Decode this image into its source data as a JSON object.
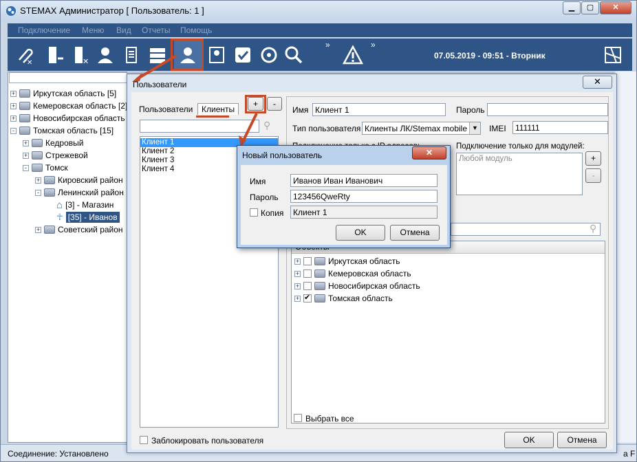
{
  "window": {
    "title": "STEMAX Администратор [ Пользователь: 1 ]"
  },
  "menu": [
    "Подключение",
    "Меню",
    "Вид",
    "Отчеты",
    "Помощь"
  ],
  "toolbar": {
    "datetime": "07.05.2019 - 09:51 - Вторник",
    "more1": "»",
    "more2": "»"
  },
  "tree": [
    {
      "label": "Иркутская область [5]",
      "level": 0,
      "sign": "+"
    },
    {
      "label": "Кемеровская область [2]",
      "level": 0,
      "sign": "+"
    },
    {
      "label": "Новосибирская область",
      "level": 0,
      "sign": "+"
    },
    {
      "label": "Томская область [15]",
      "level": 0,
      "sign": "-"
    },
    {
      "label": "Кедровый",
      "level": 1,
      "sign": "+"
    },
    {
      "label": "Стрежевой",
      "level": 1,
      "sign": "+"
    },
    {
      "label": "Томск",
      "level": 1,
      "sign": "-"
    },
    {
      "label": "Кировский район",
      "level": 2,
      "sign": "+"
    },
    {
      "label": "Ленинский район",
      "level": 2,
      "sign": "-"
    },
    {
      "label": "[3] - Магазин",
      "level": 3,
      "sign": ""
    },
    {
      "label": "[35] - Иванов",
      "level": 3,
      "sign": ""
    },
    {
      "label": "Советский район",
      "level": 2,
      "sign": "+"
    }
  ],
  "status": {
    "connection": "Соединение: Установлено",
    "right": "a F"
  },
  "users_dialog": {
    "title": "Пользователи",
    "tabs": [
      "Пользователи",
      "Клиенты"
    ],
    "add": "+",
    "remove": "-",
    "clients": [
      "Клиент 1",
      "Клиент 2",
      "Клиент 3",
      "Клиент 4"
    ],
    "name_label": "Имя",
    "name_value": "Клиент 1",
    "password_label": "Пароль",
    "password_value": "",
    "type_label": "Тип пользователя",
    "type_value": "Клиенты ЛК/Stemax mobile",
    "imei_label": "IMEI",
    "imei_value": "111111",
    "ip_label": "Подключение только с IP адресов:",
    "modules_label": "Подключение только для модулей:",
    "modules_placeholder": "Любой модуль",
    "mod_add": "+",
    "mod_remove": "-",
    "objects_header": "Объекты",
    "objects": [
      {
        "label": "Иркутская область",
        "checked": false
      },
      {
        "label": "Кемеровская область",
        "checked": false
      },
      {
        "label": "Новосибирская область",
        "checked": false
      },
      {
        "label": "Томская область",
        "checked": true
      }
    ],
    "select_all": "Выбрать все",
    "block_user": "Заблокировать пользователя",
    "ok": "OK",
    "cancel": "Отмена"
  },
  "new_user": {
    "title": "Новый пользователь",
    "name_label": "Имя",
    "name_value": "Иванов Иван Иванович",
    "password_label": "Пароль",
    "password_value": "123456QweRty",
    "copy_label": "Копия",
    "copy_value": "Клиент 1",
    "ok": "OK",
    "cancel": "Отмена"
  },
  "colors": {
    "toolbar": "#2f5486",
    "accent": "#c44a2a",
    "selection": "#3399ff"
  }
}
